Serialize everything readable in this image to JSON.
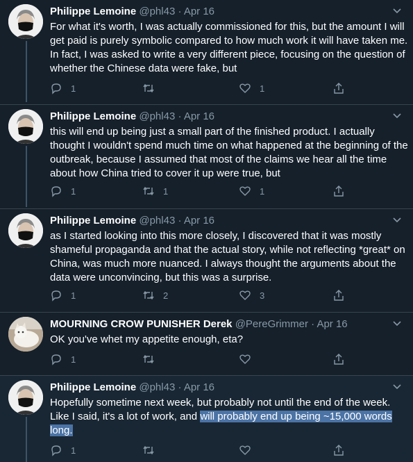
{
  "tweets": [
    {
      "name": "Philippe Lemoine",
      "handle": "@phl43",
      "date": "Apr 16",
      "text": "For what it's worth, I was actually commissioned for this, but the amount I will get paid is purely symbolic compared to how much work it will have taken me. In fact, I was asked to write a very different piece, focusing on the question of whether the Chinese data were fake, but",
      "replies": "1",
      "retweets": "",
      "likes": "1"
    },
    {
      "name": "Philippe Lemoine",
      "handle": "@phl43",
      "date": "Apr 16",
      "text": "this will end up being just a small part of the finished product. I actually thought I wouldn't spend much time on what happened at the beginning of the outbreak, because I assumed that most of the claims we hear all the time about how China tried to cover it up were true, but",
      "replies": "1",
      "retweets": "1",
      "likes": "1"
    },
    {
      "name": "Philippe Lemoine",
      "handle": "@phl43",
      "date": "Apr 16",
      "text": "as I started looking into this more closely, I discovered that it was mostly shameful propaganda and that the actual story, while not reflecting *great* on China, was much more nuanced. I always thought the arguments about the data were unconvincing, but this was a surprise.",
      "replies": "1",
      "retweets": "2",
      "likes": "3"
    },
    {
      "name": "MOURNING CROW PUNISHER Derek",
      "handle": "@PereGrimmer",
      "date": "Apr 16",
      "text": "OK you've whet my appetite enough, eta?",
      "replies": "1",
      "retweets": "",
      "likes": ""
    },
    {
      "name": "Philippe Lemoine",
      "handle": "@phl43",
      "date": "Apr 16",
      "text_plain": "Hopefully sometime next week, but probably not until the end of the week. Like I said, it's a lot of work, and ",
      "text_selected": "will probably end up being ~15,000 words long.",
      "replies": "1",
      "retweets": "",
      "likes": ""
    }
  ],
  "separator": "·",
  "colors": {
    "background": "#15202b",
    "muted": "#8899a6",
    "selection": "#4b73a5"
  }
}
